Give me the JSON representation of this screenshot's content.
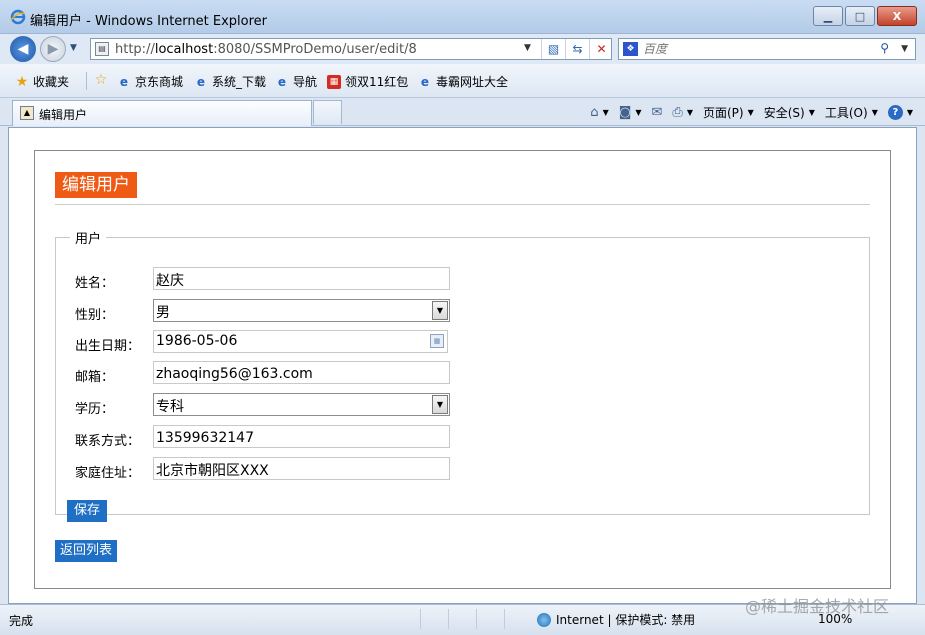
{
  "window": {
    "title": "编辑用户 - Windows Internet Explorer",
    "minimize": "▁",
    "maximize": "□",
    "close": "X"
  },
  "address_bar": {
    "url_prefix": "http://",
    "url_host": "localhost",
    "url_rest": ":8080/SSMProDemo/user/edit/8",
    "search_placeholder": "百度"
  },
  "favorites": {
    "label": "收藏夹",
    "items": [
      "京东商城",
      "系统_下载",
      "导航",
      "领双11红包",
      "毒霸网址大全"
    ]
  },
  "tabs": [
    {
      "label": "编辑用户"
    }
  ],
  "command_bar": {
    "page": "页面(P)",
    "safety": "安全(S)",
    "tools": "工具(O)"
  },
  "page": {
    "heading": "编辑用户",
    "fieldset_legend": "用户",
    "fields": [
      {
        "label": "姓名：",
        "value": "赵庆",
        "type": "text"
      },
      {
        "label": "性别：",
        "value": "男",
        "type": "select"
      },
      {
        "label": "出生日期：",
        "value": "1986-05-06",
        "type": "date"
      },
      {
        "label": "邮箱：",
        "value": "zhaoqing56@163.com",
        "type": "text"
      },
      {
        "label": "学历：",
        "value": "专科",
        "type": "select"
      },
      {
        "label": "联系方式：",
        "value": "13599632147",
        "type": "text"
      },
      {
        "label": "家庭住址：",
        "value": "北京市朝阳区XXX",
        "type": "text"
      }
    ],
    "save_button": "保存",
    "back_link": "返回列表"
  },
  "status_bar": {
    "text": "完成",
    "zone": "Internet | 保护模式: 禁用",
    "zoom": "100%"
  },
  "watermark": "@稀土掘金技术社区",
  "colors": {
    "accent": "#ef5a15",
    "button": "#1f6fc5"
  }
}
